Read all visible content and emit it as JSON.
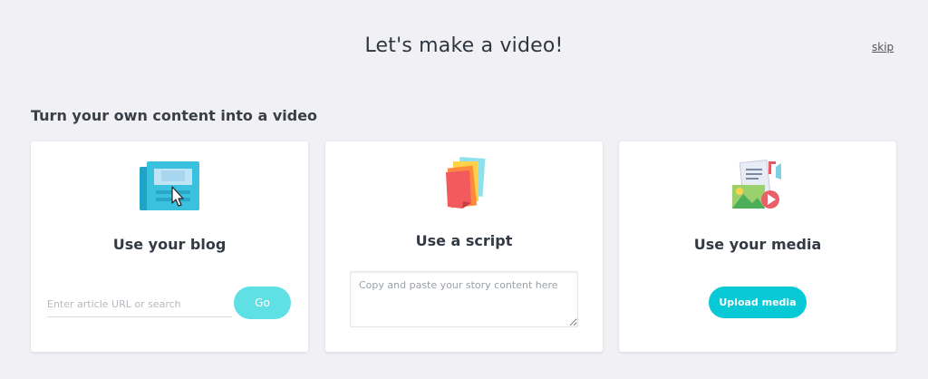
{
  "header": {
    "title": "Let's make a video!",
    "skip_label": "skip"
  },
  "section": {
    "title": "Turn your own content into a video"
  },
  "cards": {
    "blog": {
      "title": "Use your blog",
      "input_placeholder": "Enter article URL or search",
      "go_label": "Go",
      "icon": "newspaper-icon"
    },
    "script": {
      "title": "Use a script",
      "textarea_placeholder": "Copy and paste your story content here",
      "icon": "document-stack-icon"
    },
    "media": {
      "title": "Use your media",
      "upload_label": "Upload media",
      "icon": "media-collage-icon"
    }
  },
  "colors": {
    "background": "#f0f0f5",
    "accent": "#08c9d6",
    "accent_light": "#5fe0e5"
  }
}
